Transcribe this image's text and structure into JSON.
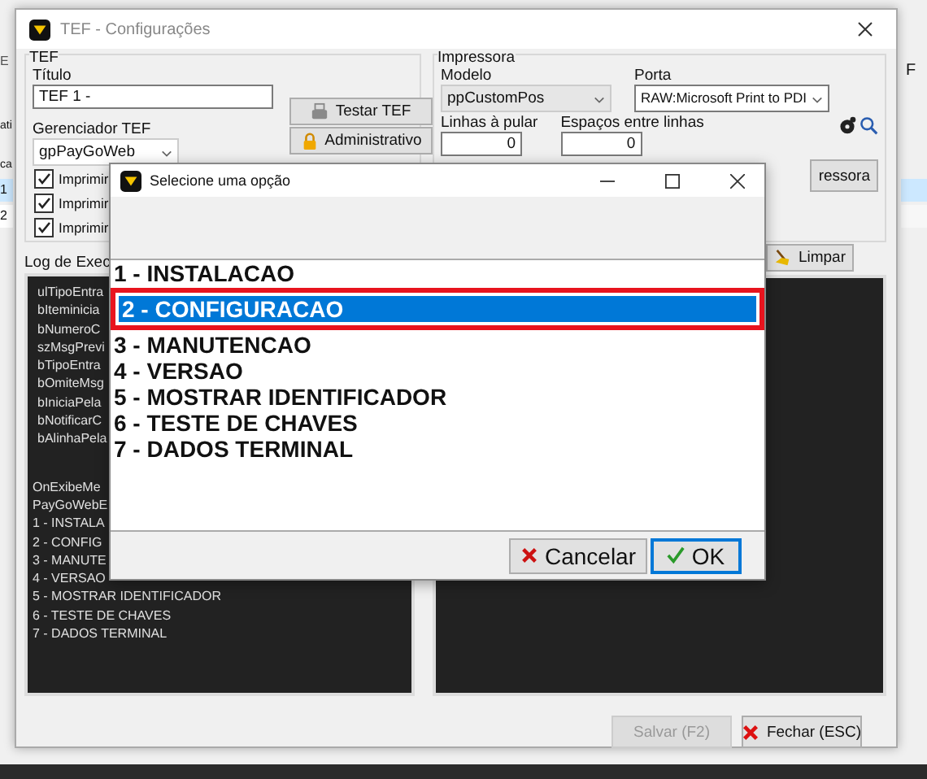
{
  "background_app": {
    "menu_fragment": "E",
    "label_fragment": "ati",
    "table": {
      "header": "ca",
      "rows": [
        {
          "cell": "1",
          "selected": true
        },
        {
          "cell": "2",
          "selected": false
        }
      ]
    },
    "right_fragment": "F"
  },
  "window": {
    "title": "TEF - Configurações"
  },
  "tef": {
    "legend": "TEF",
    "title_label": "Título",
    "title_value": "TEF 1 -",
    "manager_label": "Gerenciador TEF",
    "manager_value": "gpPayGoWeb",
    "buttons": [
      {
        "label": "Testar TEF",
        "kind": "printer"
      },
      {
        "label": "Administrativo",
        "kind": "lock"
      }
    ],
    "checkboxes": [
      {
        "label": "Imprimir",
        "checked": true
      },
      {
        "label": "Imprimir",
        "checked": true
      },
      {
        "label": "Imprimir",
        "checked": true
      }
    ]
  },
  "printer": {
    "legend": "Impressora",
    "model_label": "Modelo",
    "model_value": "ppCustomPos",
    "port_label": "Porta",
    "port_value": "RAW:Microsoft Print to PDI",
    "skip_lines_label": "Linhas à pular",
    "skip_lines_value": "0",
    "spacing_label": "Espaços entre linhas",
    "spacing_value": "0",
    "printer_button": "ressora"
  },
  "log": {
    "label": "Log de Exec",
    "clear_button": "Limpar",
    "blocks": [
      [
        "ulTipoEntra",
        "bIteminicia",
        "bNumeroC",
        "szMsgPrevi",
        "bTipoEntra",
        "bOmiteMsg",
        "bIniciaPela",
        "bNotificarC",
        "bAlinhaPela"
      ],
      [
        "OnExibeMe",
        "PayGoWebE",
        "1 - INSTALA",
        "2 - CONFIG",
        "3 - MANUTE",
        "4 - VERSAO",
        "5 - MOSTRAR IDENTIFICADOR",
        "6 - TESTE DE CHAVES",
        "7 - DADOS TERMINAL"
      ]
    ]
  },
  "footer": {
    "buttons": [
      {
        "label": "Salvar (F2)",
        "disabled": true,
        "kind": "save"
      },
      {
        "label": "Fechar (ESC)",
        "disabled": false,
        "kind": "close"
      }
    ]
  },
  "dialog": {
    "title": "Selecione uma opção",
    "options": [
      {
        "label": "1 - INSTALACAO",
        "selected": false,
        "annotated": false
      },
      {
        "label": "2 - CONFIGURACAO",
        "selected": true,
        "annotated": true
      },
      {
        "label": "3 - MANUTENCAO",
        "selected": false,
        "annotated": false
      },
      {
        "label": "4 - VERSAO",
        "selected": false,
        "annotated": false
      },
      {
        "label": "5 - MOSTRAR IDENTIFICADOR",
        "selected": false,
        "annotated": false
      },
      {
        "label": "6 - TESTE DE CHAVES",
        "selected": false,
        "annotated": false
      },
      {
        "label": "7 - DADOS TERMINAL",
        "selected": false,
        "annotated": false
      }
    ],
    "buttons": [
      {
        "label": "Cancelar",
        "kind": "cancel"
      },
      {
        "label": "OK",
        "kind": "ok"
      }
    ]
  }
}
